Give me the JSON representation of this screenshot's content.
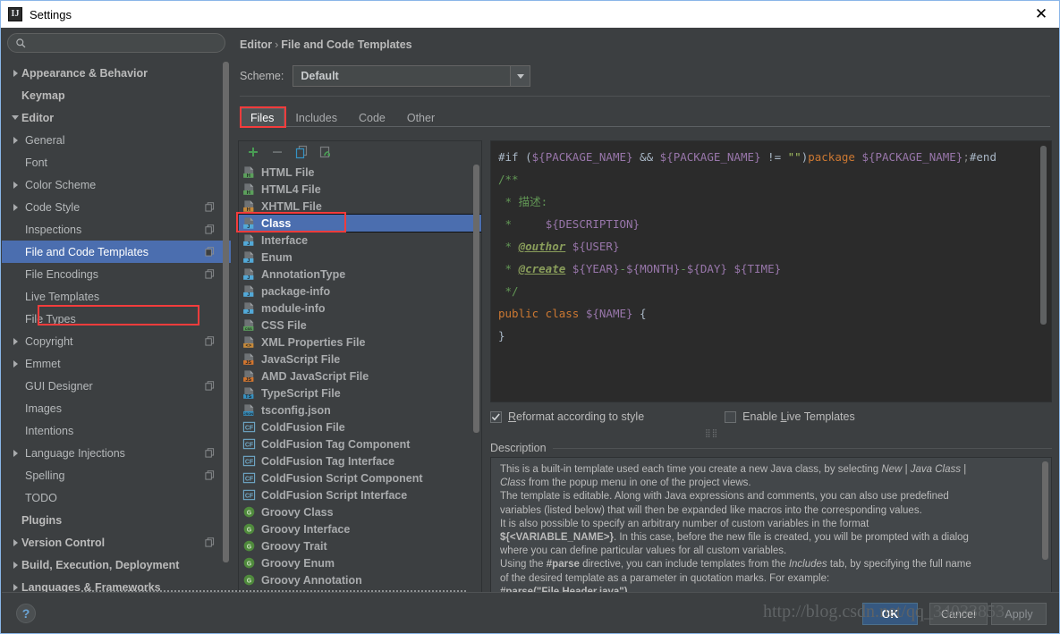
{
  "window": {
    "title": "Settings",
    "app_icon": "IJ",
    "close_icon": "✕"
  },
  "sidebar": {
    "search": {
      "value": "",
      "placeholder": "",
      "icon": "search-icon"
    },
    "items": [
      {
        "label": "Appearance & Behavior",
        "level": 0,
        "arrow": "right",
        "bold": true,
        "badge": false,
        "selected": false
      },
      {
        "label": "Keymap",
        "level": 0,
        "arrow": "none",
        "bold": true,
        "badge": false,
        "selected": false
      },
      {
        "label": "Editor",
        "level": 0,
        "arrow": "down",
        "bold": true,
        "badge": false,
        "selected": false
      },
      {
        "label": "General",
        "level": 1,
        "arrow": "right",
        "bold": false,
        "badge": false,
        "selected": false
      },
      {
        "label": "Font",
        "level": 1,
        "arrow": "none",
        "bold": false,
        "badge": false,
        "selected": false
      },
      {
        "label": "Color Scheme",
        "level": 1,
        "arrow": "right",
        "bold": false,
        "badge": false,
        "selected": false
      },
      {
        "label": "Code Style",
        "level": 1,
        "arrow": "right",
        "bold": false,
        "badge": true,
        "selected": false
      },
      {
        "label": "Inspections",
        "level": 1,
        "arrow": "none",
        "bold": false,
        "badge": true,
        "selected": false
      },
      {
        "label": "File and Code Templates",
        "level": 1,
        "arrow": "none",
        "bold": false,
        "badge": true,
        "selected": true
      },
      {
        "label": "File Encodings",
        "level": 1,
        "arrow": "none",
        "bold": false,
        "badge": true,
        "selected": false
      },
      {
        "label": "Live Templates",
        "level": 1,
        "arrow": "none",
        "bold": false,
        "badge": false,
        "selected": false
      },
      {
        "label": "File Types",
        "level": 1,
        "arrow": "none",
        "bold": false,
        "badge": false,
        "selected": false
      },
      {
        "label": "Copyright",
        "level": 1,
        "arrow": "right",
        "bold": false,
        "badge": true,
        "selected": false
      },
      {
        "label": "Emmet",
        "level": 1,
        "arrow": "right",
        "bold": false,
        "badge": false,
        "selected": false
      },
      {
        "label": "GUI Designer",
        "level": 1,
        "arrow": "none",
        "bold": false,
        "badge": true,
        "selected": false
      },
      {
        "label": "Images",
        "level": 1,
        "arrow": "none",
        "bold": false,
        "badge": false,
        "selected": false
      },
      {
        "label": "Intentions",
        "level": 1,
        "arrow": "none",
        "bold": false,
        "badge": false,
        "selected": false
      },
      {
        "label": "Language Injections",
        "level": 1,
        "arrow": "right",
        "bold": false,
        "badge": true,
        "selected": false
      },
      {
        "label": "Spelling",
        "level": 1,
        "arrow": "none",
        "bold": false,
        "badge": true,
        "selected": false
      },
      {
        "label": "TODO",
        "level": 1,
        "arrow": "none",
        "bold": false,
        "badge": false,
        "selected": false
      },
      {
        "label": "Plugins",
        "level": 0,
        "arrow": "none",
        "bold": true,
        "badge": false,
        "selected": false
      },
      {
        "label": "Version Control",
        "level": 0,
        "arrow": "right",
        "bold": true,
        "badge": true,
        "selected": false
      },
      {
        "label": "Build, Execution, Deployment",
        "level": 0,
        "arrow": "right",
        "bold": true,
        "badge": false,
        "selected": false
      },
      {
        "label": "Languages & Frameworks",
        "level": 0,
        "arrow": "right",
        "bold": true,
        "badge": false,
        "selected": false
      }
    ]
  },
  "content": {
    "breadcrumb": {
      "parent": "Editor",
      "separator": "›",
      "current": "File and Code Templates"
    },
    "scheme": {
      "label": "Scheme:",
      "value": "Default",
      "dropdown_icon": "chevron-down-icon"
    },
    "tabs": [
      {
        "label": "Files",
        "active": true
      },
      {
        "label": "Includes",
        "active": false
      },
      {
        "label": "Code",
        "active": false
      },
      {
        "label": "Other",
        "active": false
      }
    ],
    "list_toolbar": [
      {
        "name": "add-template-button",
        "icon": "plus-icon",
        "color": "#499c54"
      },
      {
        "name": "remove-template-button",
        "icon": "minus-icon",
        "color": "#6b6f71"
      },
      {
        "name": "copy-template-button",
        "icon": "copy-icon",
        "color": "#3592c4"
      },
      {
        "name": "reset-template-button",
        "icon": "reset-icon",
        "color": "#499c54"
      }
    ],
    "templates": [
      {
        "label": "HTML File",
        "icon": "html-file-icon",
        "selected": false
      },
      {
        "label": "HTML4 File",
        "icon": "html-file-icon",
        "selected": false
      },
      {
        "label": "XHTML File",
        "icon": "xhtml-file-icon",
        "selected": false
      },
      {
        "label": "Class",
        "icon": "java-file-icon",
        "selected": true
      },
      {
        "label": "Interface",
        "icon": "java-file-icon",
        "selected": false
      },
      {
        "label": "Enum",
        "icon": "java-file-icon",
        "selected": false
      },
      {
        "label": "AnnotationType",
        "icon": "java-file-icon",
        "selected": false
      },
      {
        "label": "package-info",
        "icon": "java-file-icon",
        "selected": false
      },
      {
        "label": "module-info",
        "icon": "java-file-icon",
        "selected": false
      },
      {
        "label": "CSS File",
        "icon": "css-file-icon",
        "selected": false
      },
      {
        "label": "XML Properties File",
        "icon": "xml-file-icon",
        "selected": false
      },
      {
        "label": "JavaScript File",
        "icon": "js-file-icon",
        "selected": false
      },
      {
        "label": "AMD JavaScript File",
        "icon": "js-file-icon",
        "selected": false
      },
      {
        "label": "TypeScript File",
        "icon": "ts-file-icon",
        "selected": false
      },
      {
        "label": "tsconfig.json",
        "icon": "json-file-icon",
        "selected": false
      },
      {
        "label": "ColdFusion File",
        "icon": "coldfusion-icon",
        "selected": false
      },
      {
        "label": "ColdFusion Tag Component",
        "icon": "coldfusion-icon",
        "selected": false
      },
      {
        "label": "ColdFusion Tag Interface",
        "icon": "coldfusion-icon",
        "selected": false
      },
      {
        "label": "ColdFusion Script Component",
        "icon": "coldfusion-icon",
        "selected": false
      },
      {
        "label": "ColdFusion Script Interface",
        "icon": "coldfusion-icon",
        "selected": false
      },
      {
        "label": "Groovy Class",
        "icon": "groovy-icon",
        "selected": false
      },
      {
        "label": "Groovy Interface",
        "icon": "groovy-icon",
        "selected": false
      },
      {
        "label": "Groovy Trait",
        "icon": "groovy-icon",
        "selected": false
      },
      {
        "label": "Groovy Enum",
        "icon": "groovy-icon",
        "selected": false
      },
      {
        "label": "Groovy Annotation",
        "icon": "groovy-icon",
        "selected": false
      }
    ],
    "editor_code": [
      "#if (${PACKAGE_NAME} && ${PACKAGE_NAME} != \"\")package ${PACKAGE_NAME};#end",
      "/**",
      " * 描述:",
      " *     ${DESCRIPTION}",
      " * @outhor ${USER}",
      " * @create ${YEAR}-${MONTH}-${DAY} ${TIME}",
      " */",
      "public class ${NAME} {",
      "",
      "}"
    ],
    "checkboxes": [
      {
        "label": "Reformat according to style",
        "mnemonic": "R",
        "checked": true,
        "check_icon": "check-icon"
      },
      {
        "label": "Enable Live Templates",
        "mnemonic": "L",
        "checked": false,
        "check_icon": "check-icon"
      }
    ],
    "description_label": "Description",
    "description_text": [
      "This is a built-in template used each time you create a new Java class, by selecting <i>New</i> | <i>Java Class</i> |",
      "<i>Class</i> from the popup menu in one of the project views.",
      "The template is editable. Along with Java expressions and comments, you can also use predefined",
      "variables (listed below) that will then be expanded like macros into the corresponding values.",
      "It is also possible to specify an arbitrary number of custom variables in the format",
      "<b>${&lt;VARIABLE_NAME&gt;}</b>. In this case, before the new file is created, you will be prompted with a dialog",
      "where you can define particular values for all custom variables.",
      "Using the <b>#parse</b> directive, you can include templates from the <i>Includes</i> tab, by specifying the full name",
      "of the desired template as a parameter in quotation marks. For example:",
      "<b>#parse(\"File Header.java\")</b>"
    ]
  },
  "footer": {
    "help_label": "?",
    "ok_label": "OK",
    "cancel_label": "Cancel",
    "apply_label": "Apply",
    "watermark": "http://blog.csdn.net/qq_34033853"
  },
  "colors": {
    "accent_selection": "#4b6eaf",
    "highlight_box": "#f43c3c",
    "panel_bg": "#3c3f41",
    "editor_bg": "#2b2b2b",
    "ok_button": "#365880"
  }
}
